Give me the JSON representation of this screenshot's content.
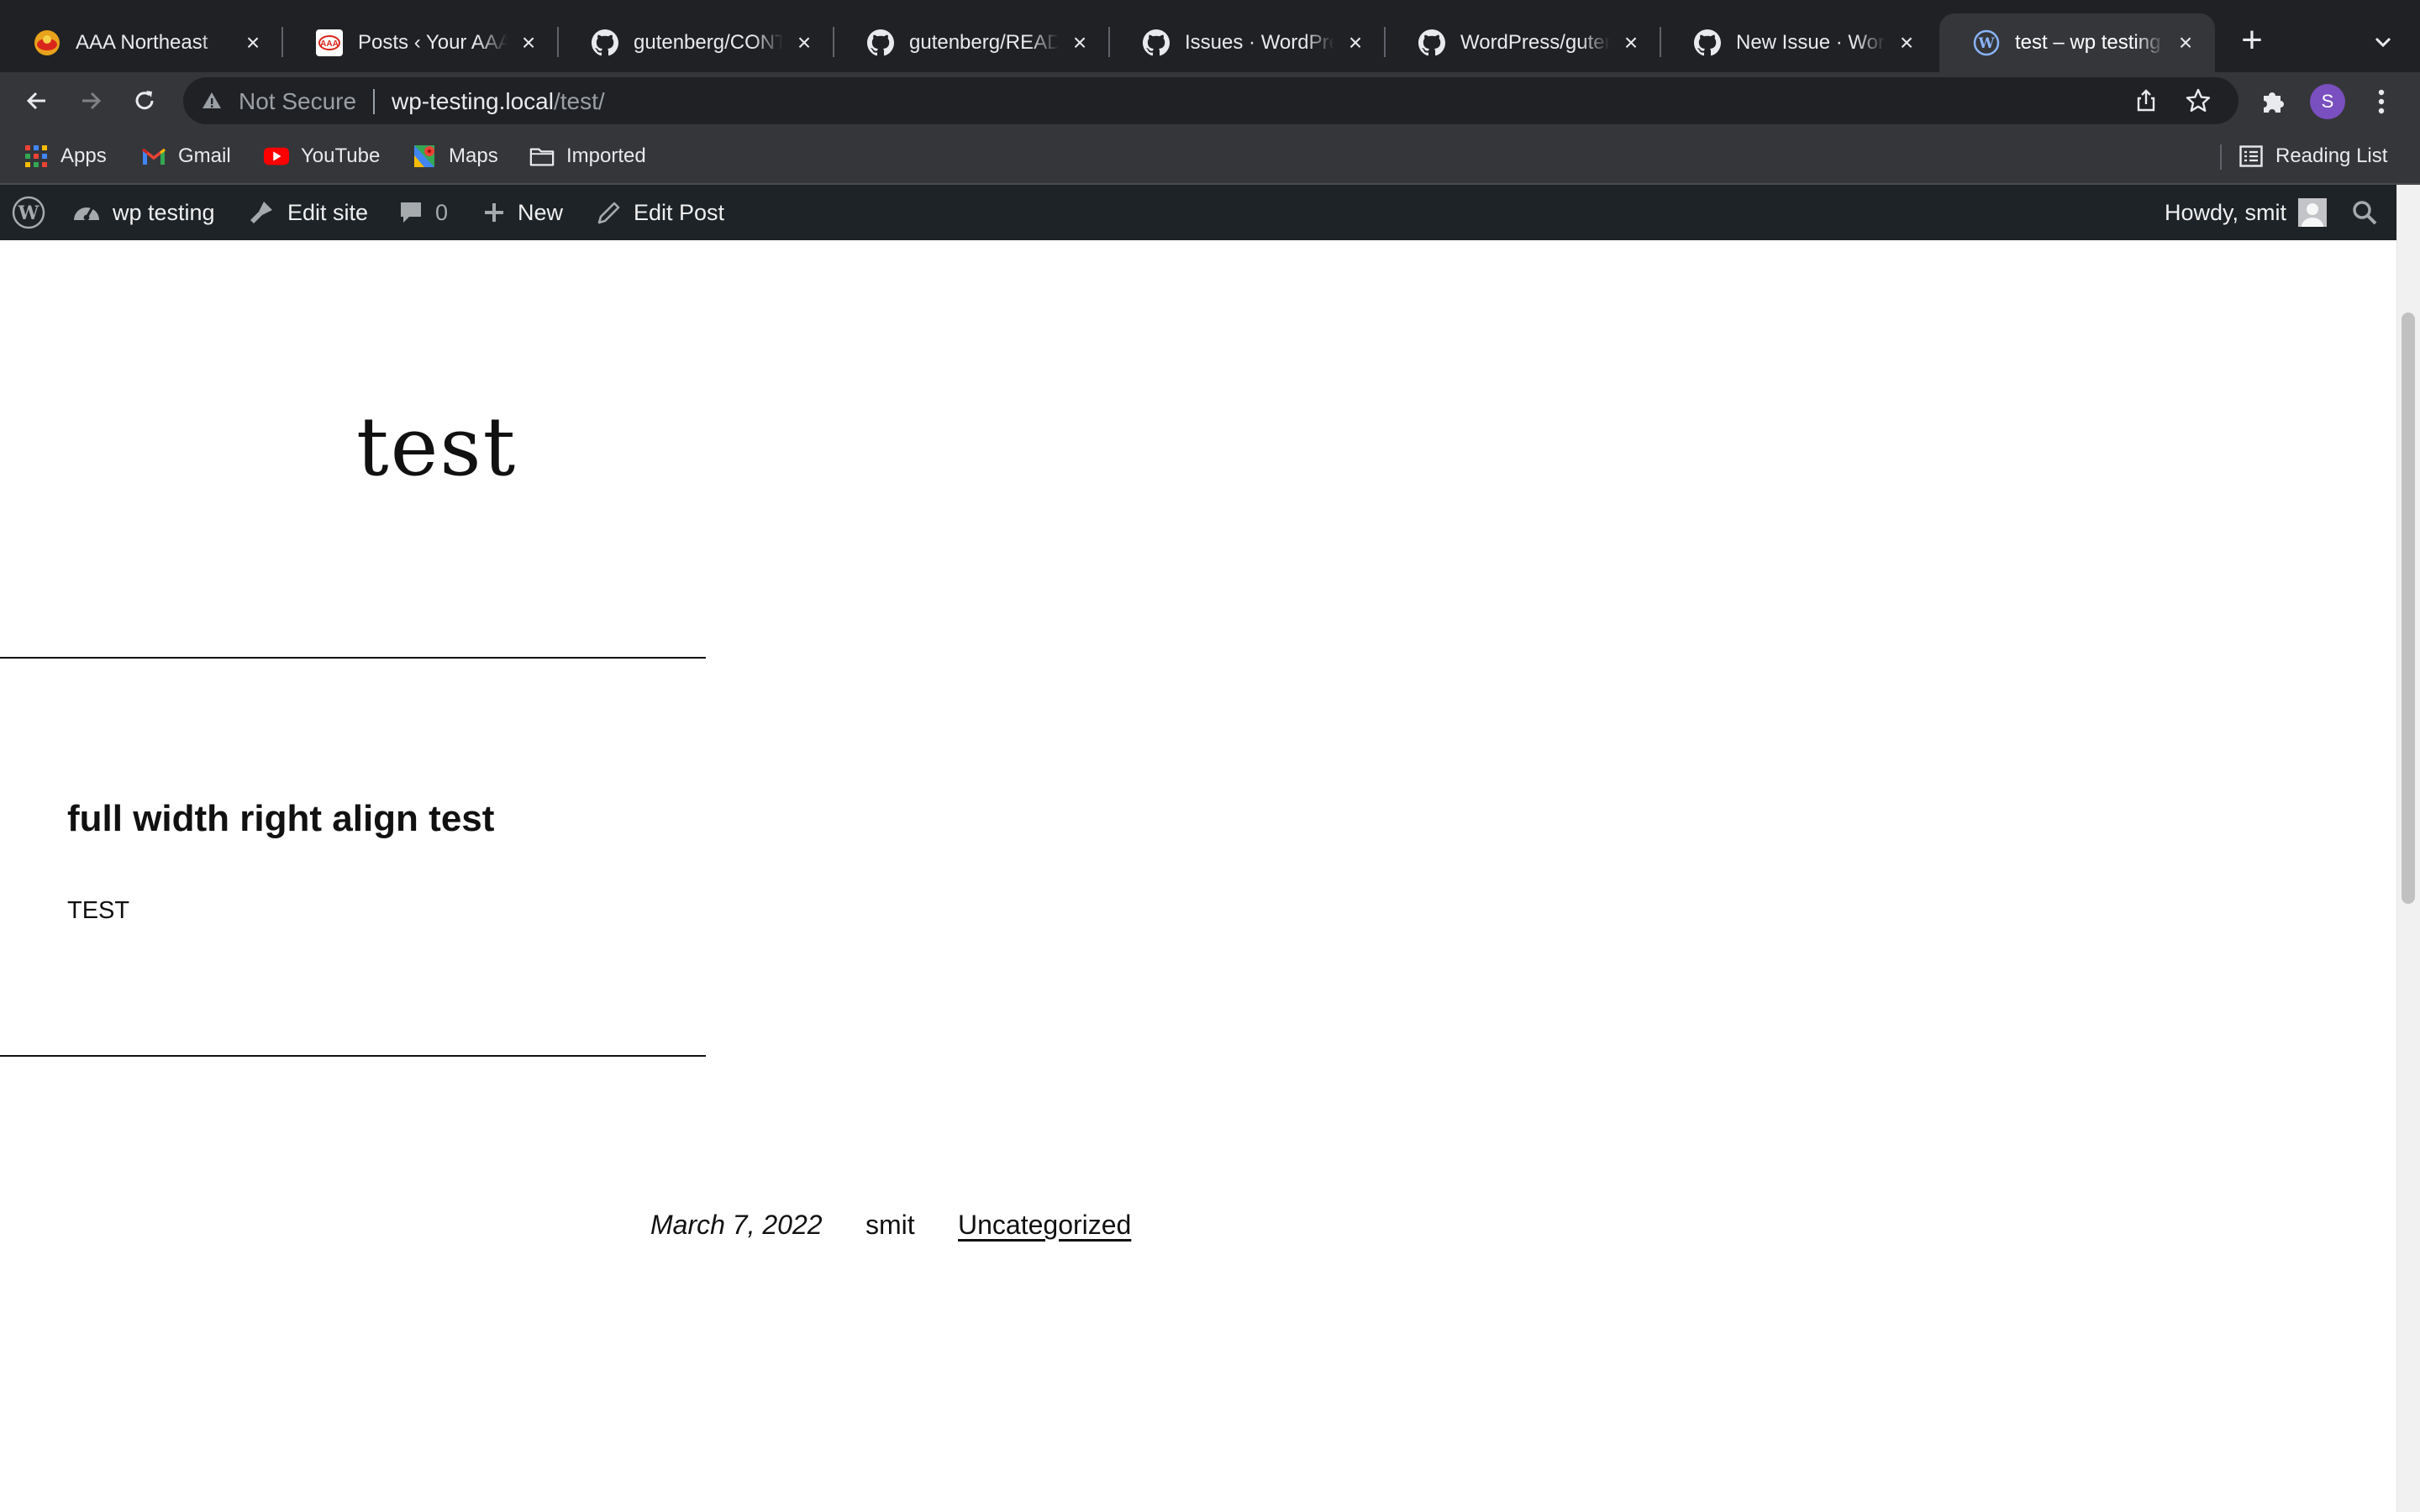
{
  "browser": {
    "tabs": [
      {
        "title": "AAA Northeast",
        "favicon": "aaa-icon",
        "active": false
      },
      {
        "title": "Posts ‹ Your AAA",
        "favicon": "aaa-posts-icon",
        "active": false
      },
      {
        "title": "gutenberg/CONTRIBUTING",
        "favicon": "github-icon",
        "active": false
      },
      {
        "title": "gutenberg/README",
        "favicon": "github-icon",
        "active": false
      },
      {
        "title": "Issues · WordPress",
        "favicon": "github-icon",
        "active": false
      },
      {
        "title": "WordPress/gutenberg",
        "favicon": "github-icon",
        "active": false
      },
      {
        "title": "New Issue · WordPress",
        "favicon": "github-icon",
        "active": false
      },
      {
        "title": "test – wp testing",
        "favicon": "wordpress-icon",
        "active": true
      }
    ],
    "omnibox": {
      "security_label": "Not Secure",
      "url_host": "wp-testing.local",
      "url_path": "/test/"
    },
    "profile_initial": "S",
    "bookmarks": [
      {
        "label": "Apps",
        "icon": "apps-grid-icon"
      },
      {
        "label": "Gmail",
        "icon": "gmail-icon"
      },
      {
        "label": "YouTube",
        "icon": "youtube-icon"
      },
      {
        "label": "Maps",
        "icon": "maps-icon"
      },
      {
        "label": "Imported",
        "icon": "folder-icon"
      }
    ],
    "reading_list_label": "Reading List"
  },
  "admin_bar": {
    "site_name": "wp testing",
    "edit_site": "Edit site",
    "comments_count": "0",
    "new_label": "New",
    "edit_post": "Edit Post",
    "howdy": "Howdy, smit"
  },
  "post": {
    "title": "test",
    "heading": "full width right align test",
    "paragraph": "TEST",
    "date": "March 7, 2022",
    "author": "smit",
    "category": "Uncategorized"
  },
  "colors": {
    "tabstrip_bg": "#202124",
    "toolbar_bg": "#35363a",
    "adminbar_bg": "#1d2327",
    "profile_bg": "#7a4fbf"
  }
}
